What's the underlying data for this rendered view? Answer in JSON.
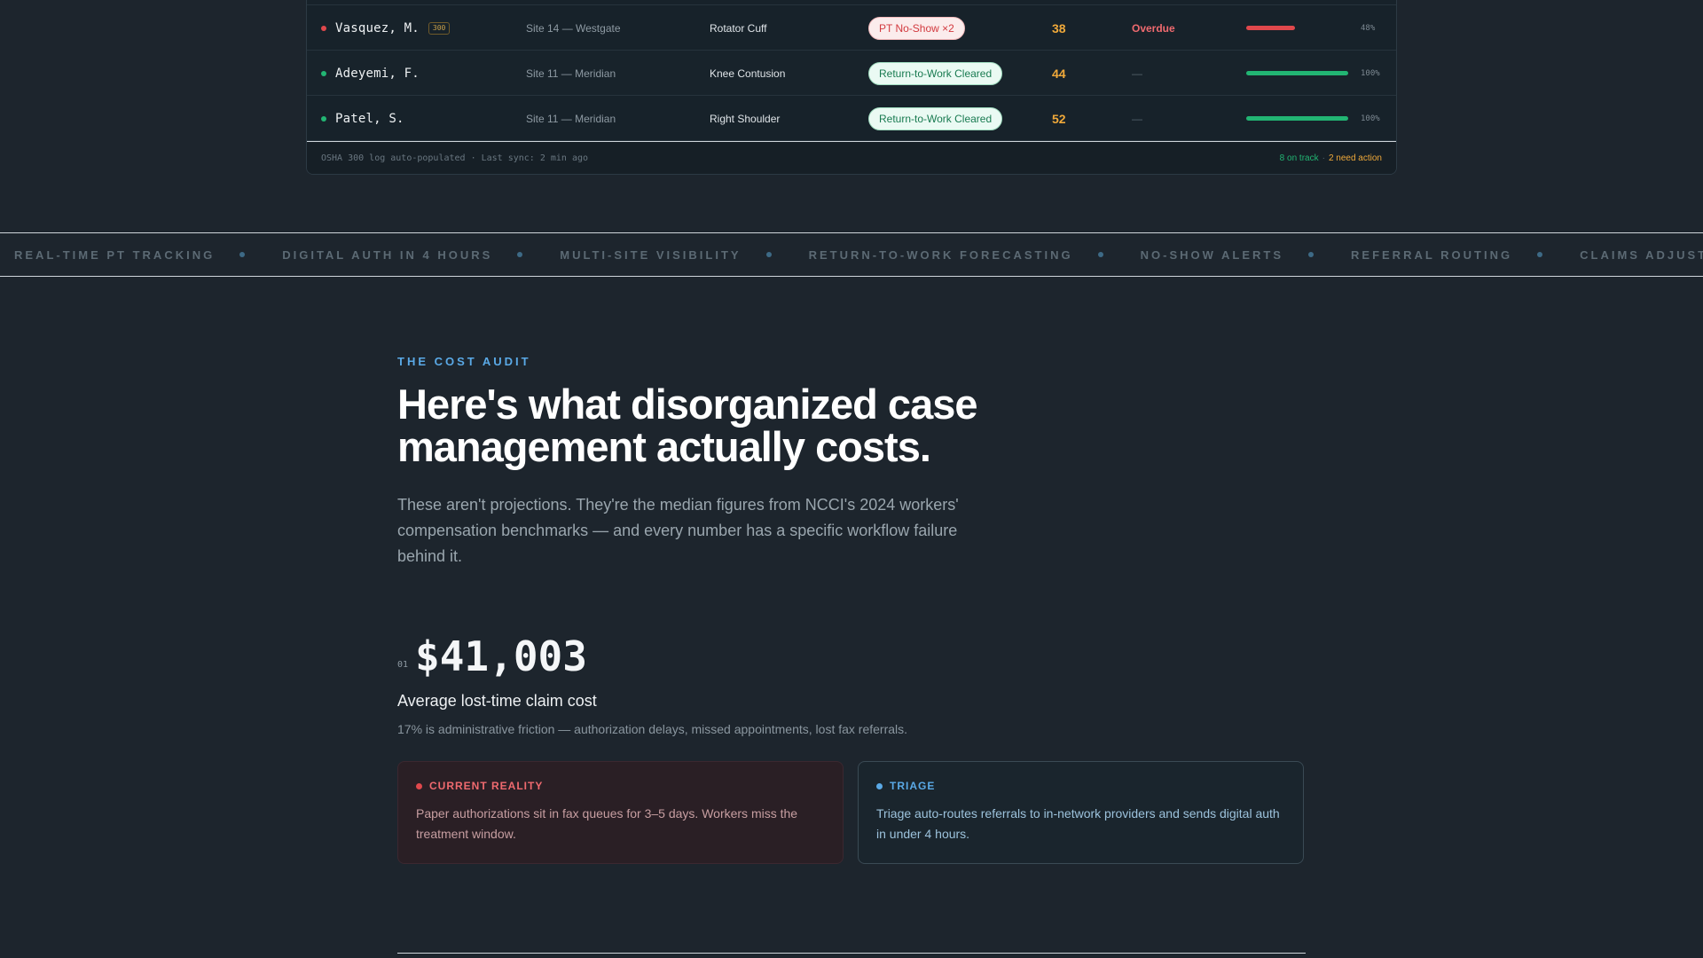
{
  "cases": {
    "rows": [
      {
        "name": "Vasquez, M.",
        "tag": "300",
        "site": "Site 14 — Westgate",
        "injury": "Rotator Cuff",
        "status": "PT No-Show ×2",
        "day": "38",
        "flag": "Overdue",
        "progress": 0.48,
        "progress_label": "48%"
      },
      {
        "name": "Adeyemi, F.",
        "tag": "",
        "site": "Site 11 — Meridian",
        "injury": "Knee Contusion",
        "status": "Return-to-Work Cleared",
        "day": "44",
        "flag": "—",
        "progress": 1.0,
        "progress_label": "100%"
      },
      {
        "name": "Patel, S.",
        "tag": "",
        "site": "Site 11 — Meridian",
        "injury": "Right Shoulder",
        "status": "Return-to-Work Cleared",
        "day": "52",
        "flag": "—",
        "progress": 1.0,
        "progress_label": "100%"
      }
    ],
    "footer_left": "OSHA 300 log auto-populated · Last sync: 2 min ago",
    "footer_ok": "8 on track",
    "footer_sep": "·",
    "footer_warn": "2 need action"
  },
  "ticker": {
    "items": [
      "REAL-TIME PT TRACKING",
      "DIGITAL AUTH IN 4 HOURS",
      "MULTI-SITE VISIBILITY",
      "RETURN-TO-WORK FORECASTING",
      "NO-SHOW ALERTS",
      "REFERRAL ROUTING",
      "CLAIMS ADJUSTER PORTAL"
    ]
  },
  "audit": {
    "eyebrow": "THE COST AUDIT",
    "headline": "Here's what disorganized case management actually costs.",
    "lede": "These aren't projections. They're the median figures from NCCI's 2024 workers' compensation benchmarks — and every number has a specific workflow failure behind it.",
    "stat_index": "01",
    "stat_value": "$41,003",
    "stat_title": "Average lost-time claim cost",
    "stat_sub": "17% is administrative friction — authorization delays, missed appointments, lost fax referrals.",
    "card_bad_label": "CURRENT REALITY",
    "card_bad_body": "Paper authorizations sit in fax queues for 3–5 days. Workers miss the treatment window.",
    "card_good_label": "TRIAGE",
    "card_good_body": "Triage auto-routes referrals to in-network providers and sends digital auth in under 4 hours."
  },
  "colors": {
    "background": "#1d252d",
    "accent_blue": "#5aa9e6",
    "danger": "#e0484c",
    "success": "#22b573",
    "warning": "#f0a93a"
  }
}
